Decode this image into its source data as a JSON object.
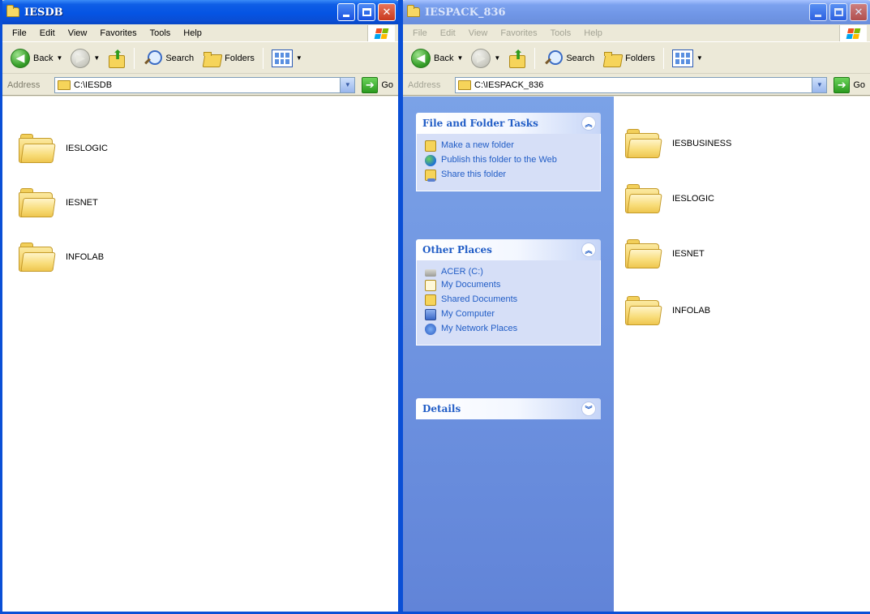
{
  "left_window": {
    "title": "IESDB",
    "menu": [
      "File",
      "Edit",
      "View",
      "Favorites",
      "Tools",
      "Help"
    ],
    "toolbar": {
      "back": "Back",
      "search": "Search",
      "folders": "Folders"
    },
    "address": {
      "label": "Address",
      "path": "C:\\IESDB",
      "go": "Go"
    },
    "folders": [
      "IESLOGIC",
      "IESNET",
      "INFOLAB"
    ]
  },
  "right_window": {
    "title": "IESPACK_836",
    "menu": [
      "File",
      "Edit",
      "View",
      "Favorites",
      "Tools",
      "Help"
    ],
    "toolbar": {
      "back": "Back",
      "search": "Search",
      "folders": "Folders"
    },
    "address": {
      "label": "Address",
      "path": "C:\\IESPACK_836",
      "go": "Go"
    },
    "task_pane": {
      "file_folder_tasks": {
        "title": "File and Folder Tasks",
        "items": [
          "Make a new folder",
          "Publish this folder to the Web",
          "Share this folder"
        ]
      },
      "other_places": {
        "title": "Other Places",
        "items": [
          "ACER (C:)",
          "My Documents",
          "Shared Documents",
          "My Computer",
          "My Network Places"
        ]
      },
      "details": {
        "title": "Details"
      }
    },
    "folders": [
      "IESBUSINESS",
      "IESLOGIC",
      "IESNET",
      "INFOLAB"
    ]
  },
  "colors": {
    "titlebar_active": "#0554e3",
    "titlebar_inactive": "#7096e6",
    "task_pane_bg": "#6e93e0",
    "task_link": "#215dc6"
  },
  "icons": {
    "back": "back-arrow-icon",
    "forward": "forward-arrow-icon",
    "up": "up-folder-icon",
    "search": "search-icon",
    "folders": "folders-icon",
    "views": "views-icon",
    "go": "go-arrow-icon"
  }
}
